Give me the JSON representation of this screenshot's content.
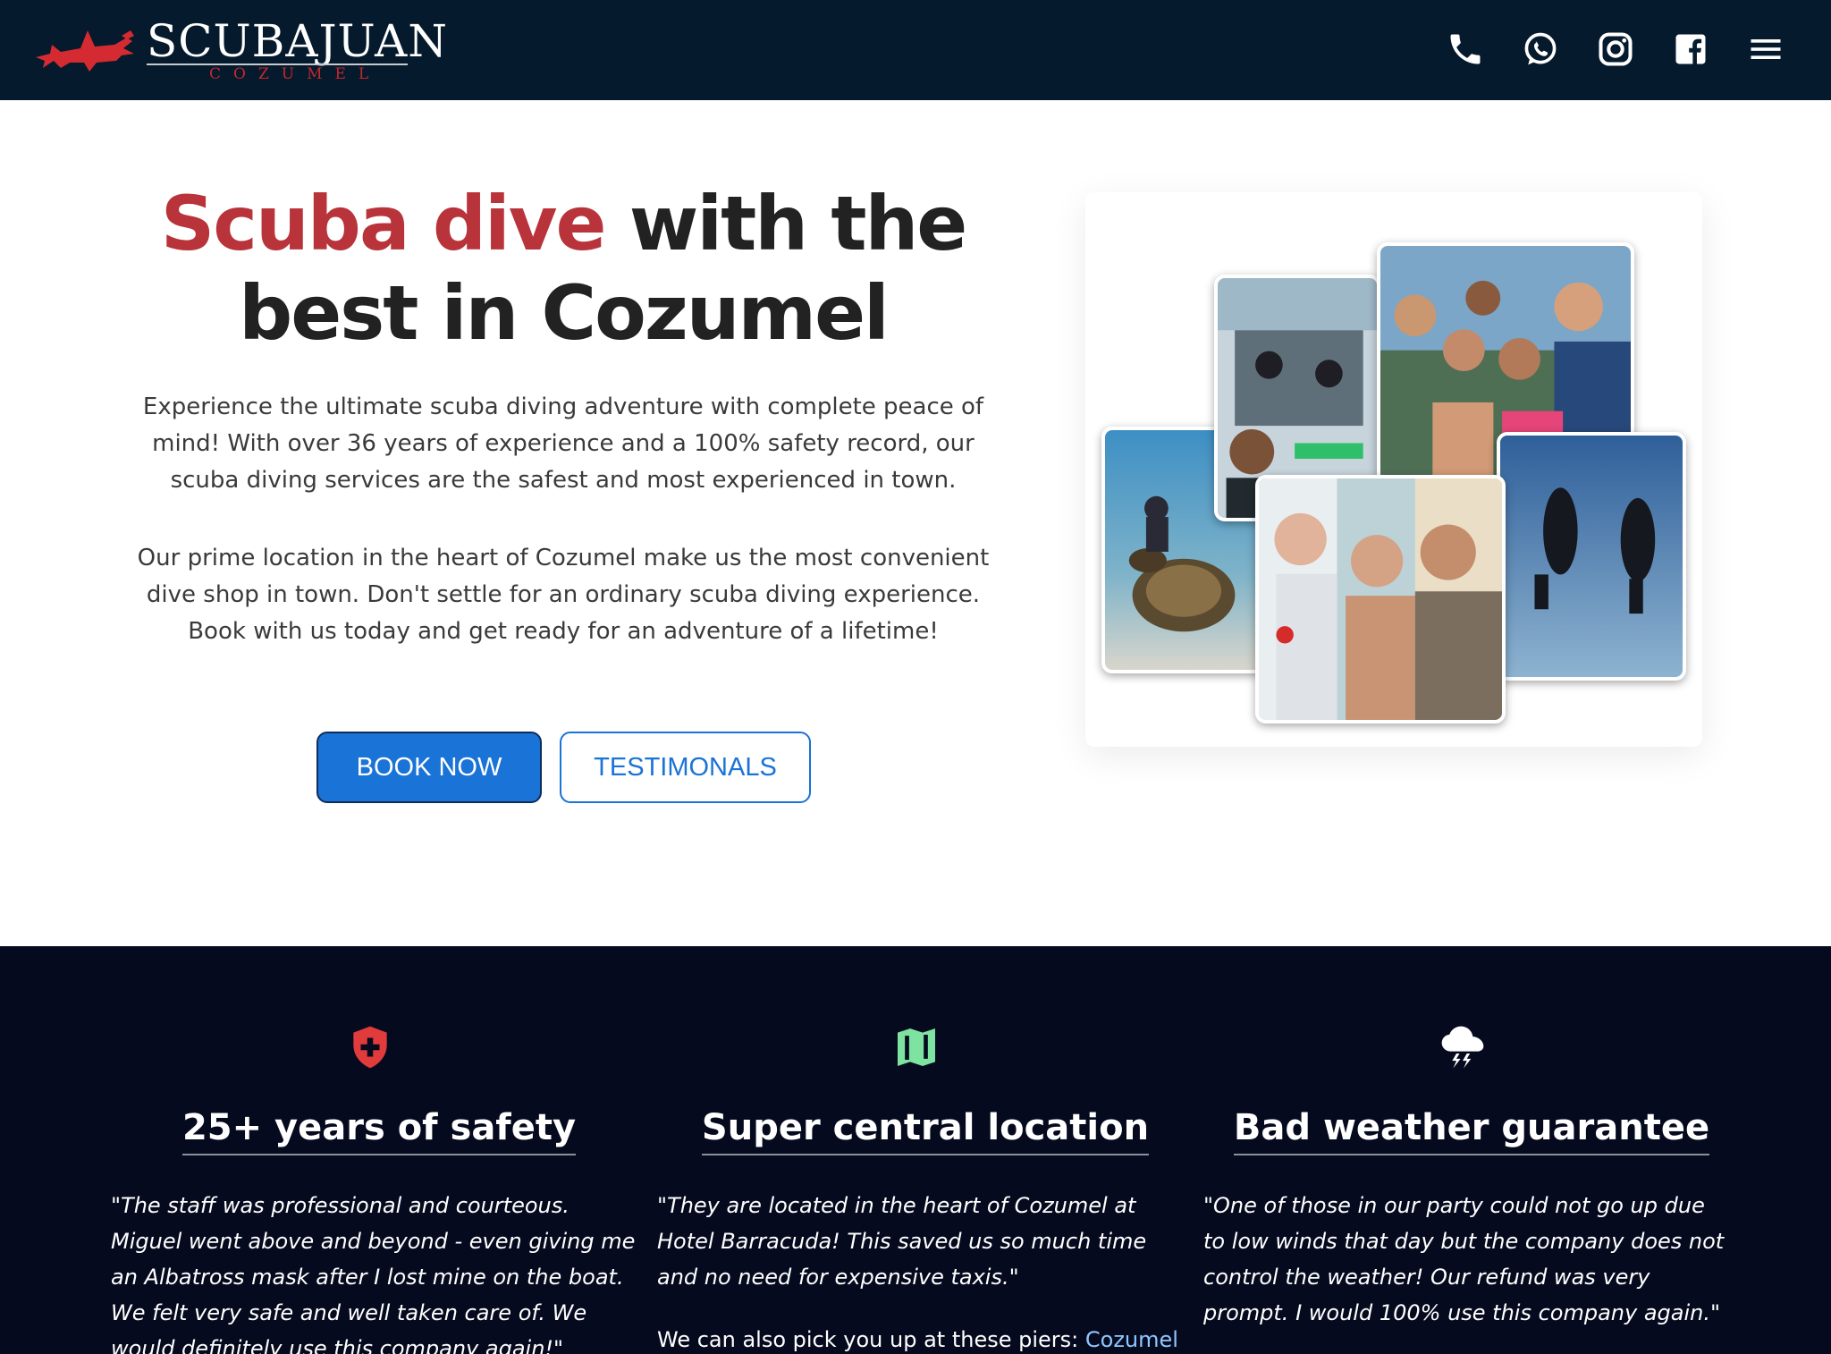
{
  "header": {
    "brand": "SCUBAJUAN",
    "brand_sub": "COZUMEL",
    "icons": [
      "phone-icon",
      "whatsapp-icon",
      "instagram-icon",
      "facebook-icon",
      "menu-icon"
    ],
    "bg_color": "#051a2c"
  },
  "hero": {
    "title_accent": "Scuba dive",
    "title_rest": " with the best in Cozumel",
    "accent_color": "#b8343a",
    "paragraph1": "Experience the ultimate scuba diving adventure with complete peace of mind! With over 36 years of experience and a 100% safety record, our scuba diving services are the safest and most experienced in town.",
    "paragraph2": "Our prime location in the heart of Cozumel make us the most convenient dive shop in town. Don't settle for an ordinary scuba diving experience. Book with us today and get ready for an adventure of a lifetime!",
    "book_button": "BOOK NOW",
    "testimonials_button": "TESTIMONALS",
    "button_color": "#1a73d6"
  },
  "features": [
    {
      "icon": "shield-plus-icon",
      "icon_color": "#e23b3b",
      "title": "25+ years of safety",
      "quote": "\"The staff was professional and courteous. Miguel went above and beyond - even giving me an Albatross mask after I lost mine on the boat. We felt very safe and well taken care of. We would definitely use this company again!\""
    },
    {
      "icon": "map-icon",
      "icon_color": "#7ee2a0",
      "title": "Super central location",
      "quote": "\"They are located in the heart of Cozumel at Hotel Barracuda! This saved us so much time and no need for expensive taxis.\"",
      "extra": "We can also pick you up at these piers: ",
      "extra_link": "Cozumel"
    },
    {
      "icon": "storm-cloud-icon",
      "icon_color": "#ffffff",
      "title": "Bad weather guarantee",
      "quote": "\"One of those in our party could not go up due to low winds that day but the company does not control the weather! Our refund was very prompt. I would 100% use this company again.\""
    }
  ],
  "features_bg": "#060a1e"
}
